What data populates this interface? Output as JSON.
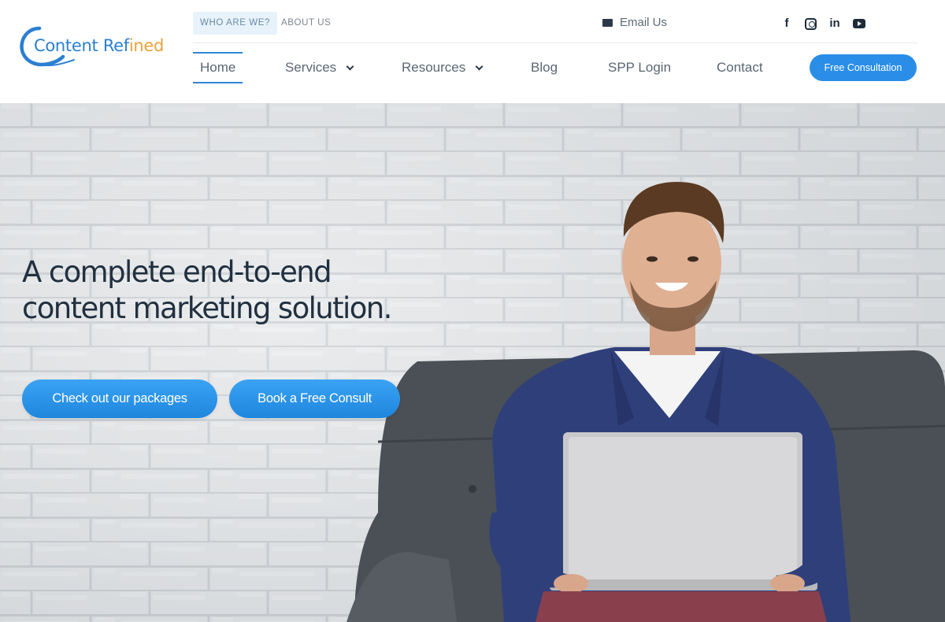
{
  "brand": {
    "logo_word1": "Content",
    "logo_word2_a": "Ref",
    "logo_word2_b": "i",
    "logo_word2_c": "ned"
  },
  "topbar": {
    "who_label": "WHO ARE WE?",
    "about_label": "ABOUT US",
    "email_label": "Email Us",
    "social": [
      "facebook-icon",
      "instagram-icon",
      "linkedin-icon",
      "youtube-icon"
    ],
    "facebook_glyph": "f",
    "linkedin_glyph": "in"
  },
  "nav": {
    "items": [
      {
        "label": "Home",
        "active": true
      },
      {
        "label": "Services",
        "dropdown": true
      },
      {
        "label": "Resources",
        "dropdown": true
      },
      {
        "label": "Blog"
      },
      {
        "label": "SPP Login"
      },
      {
        "label": "Contact"
      }
    ],
    "cta_label": "Free Consultation"
  },
  "hero": {
    "headline_line1": "A complete end-to-end",
    "headline_line2": "content marketing solution.",
    "cta_primary": "Check out our packages",
    "cta_secondary": "Book a Free Consult"
  },
  "colors": {
    "accent": "#2a8ee8",
    "brand_blue": "#2b7fd1",
    "brand_orange": "#e8a23a",
    "heading": "#213040"
  }
}
